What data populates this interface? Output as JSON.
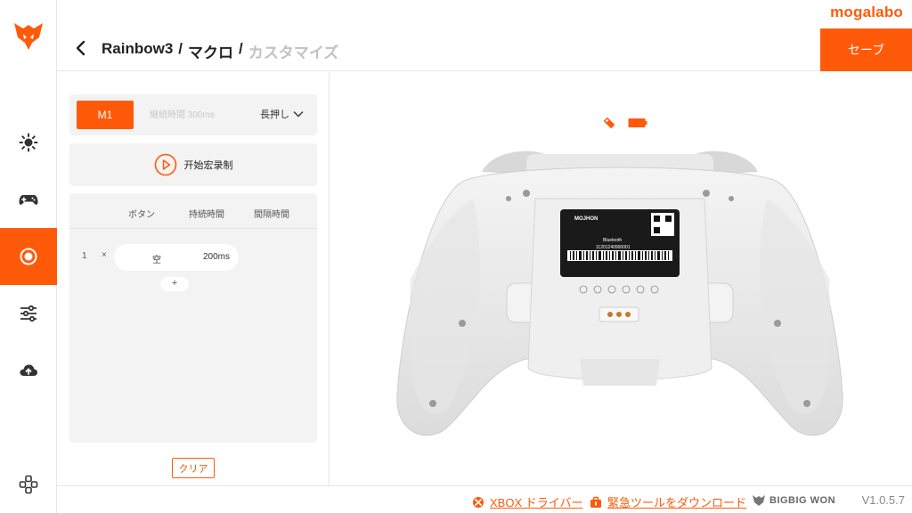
{
  "brand": "mogalabo",
  "header": {
    "crumbs": [
      "Rainbow3",
      "マクロ",
      "カスタマイズ"
    ],
    "separator": "/",
    "save_label": "セーブ"
  },
  "sidebar": {
    "items": [
      {
        "name": "lighting",
        "icon": "sun-icon"
      },
      {
        "name": "controller",
        "icon": "gamepad-icon"
      },
      {
        "name": "macro",
        "icon": "record-icon",
        "active": true
      },
      {
        "name": "settings",
        "icon": "sliders-icon"
      },
      {
        "name": "firmware",
        "icon": "cloud-upload-icon"
      },
      {
        "name": "devices",
        "icon": "dpad-icon"
      }
    ]
  },
  "macro": {
    "slot_label": "M1",
    "duration_placeholder": "継続時間 300ms",
    "mode_label": "長押し",
    "record_label": "开始宏录制",
    "columns": [
      "ボタン",
      "持続時間",
      "間隔時間"
    ],
    "steps": [
      {
        "index": "1",
        "delete": "×",
        "button": "空",
        "interval": "200ms"
      }
    ],
    "add_label": "+",
    "clear_label": "クリア"
  },
  "device_label": {
    "brand": "MOJHON",
    "serial": "11201240900001",
    "radio": "Bluetooth"
  },
  "footer": {
    "xbox_driver": "XBOX ドライバー",
    "emergency_tool": "緊急ツールをダウンロード",
    "partner": "BIGBIG WON",
    "version": "V1.0.5.7"
  },
  "colors": {
    "accent": "#ff5a0a",
    "panel": "#f3f3f3"
  }
}
